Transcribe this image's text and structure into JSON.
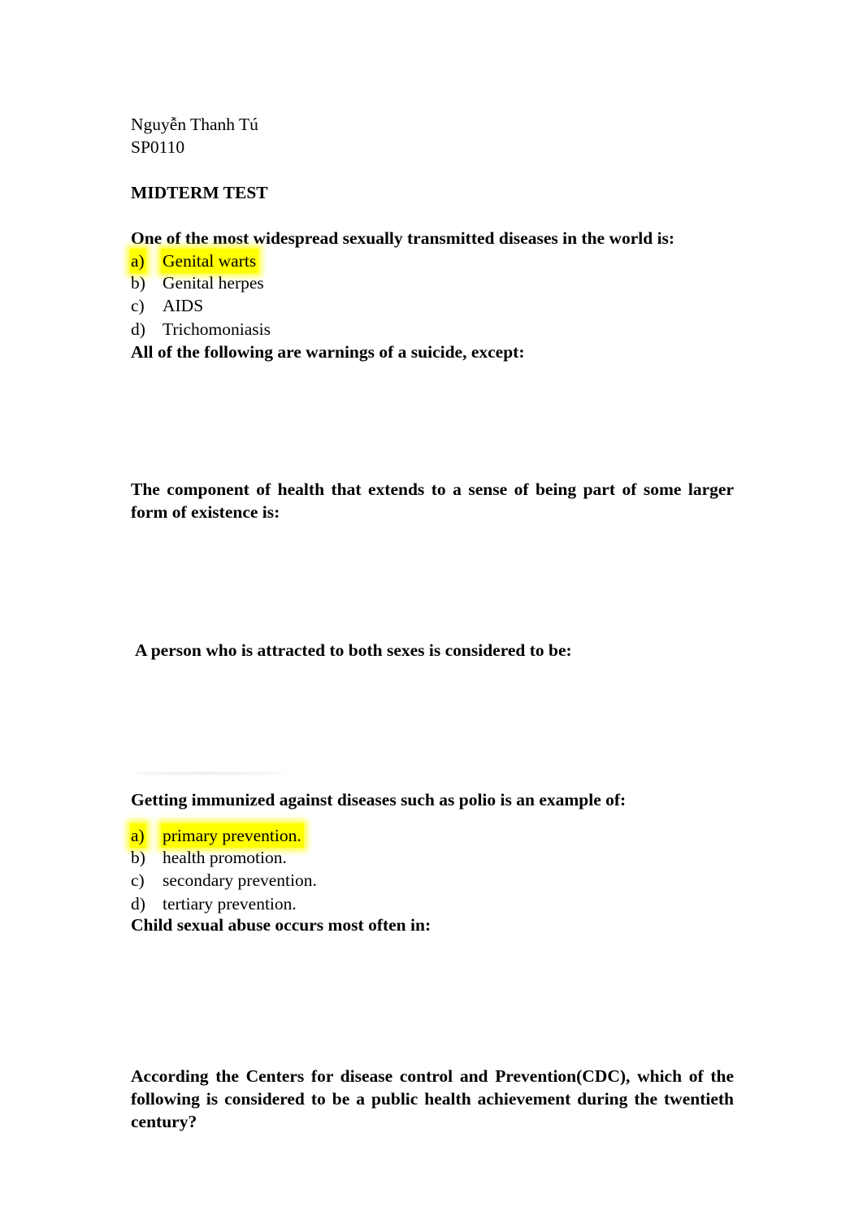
{
  "document": {
    "author": "Nguyễn Thanh Tú",
    "course_code": "SP0110",
    "title": "MIDTERM TEST",
    "highlight_color": "#ffff00"
  },
  "questions": [
    {
      "id": "q1",
      "stem": "One of the most widespread sexually transmitted diseases in the world is:",
      "options": [
        {
          "marker": "a)",
          "text": "Genital warts",
          "highlighted": true
        },
        {
          "marker": "b)",
          "text": "Genital herpes",
          "highlighted": false
        },
        {
          "marker": "c)",
          "text": "AIDS",
          "highlighted": false
        },
        {
          "marker": "d)",
          "text": "Trichomoniasis",
          "highlighted": false
        }
      ]
    },
    {
      "id": "q2",
      "stem": "All of the following are warnings of a suicide, except:",
      "options": []
    },
    {
      "id": "q3",
      "stem_line1": "The component of health that extends to a sense of being part of some larger",
      "stem_line2": "form of existence is:",
      "options": []
    },
    {
      "id": "q4",
      "stem": "A person who is attracted to both sexes is considered to be:",
      "options": []
    },
    {
      "id": "q5",
      "stem": "Getting immunized against diseases such as polio is an example of:",
      "options": [
        {
          "marker": "a)",
          "text": "primary prevention.",
          "highlighted": true
        },
        {
          "marker": "b)",
          "text": "health promotion.",
          "highlighted": false
        },
        {
          "marker": "c)",
          "text": "secondary prevention.",
          "highlighted": false
        },
        {
          "marker": "d)",
          "text": "tertiary prevention.",
          "highlighted": false
        }
      ]
    },
    {
      "id": "q6",
      "stem": "Child sexual abuse occurs most often in:",
      "options": []
    },
    {
      "id": "q7",
      "stem_line1": "According the Centers for disease control and Prevention(CDC), which of the",
      "stem_line2": "following is considered to be a public health achievement during the twentieth",
      "stem_line3": "century?",
      "options": []
    }
  ]
}
